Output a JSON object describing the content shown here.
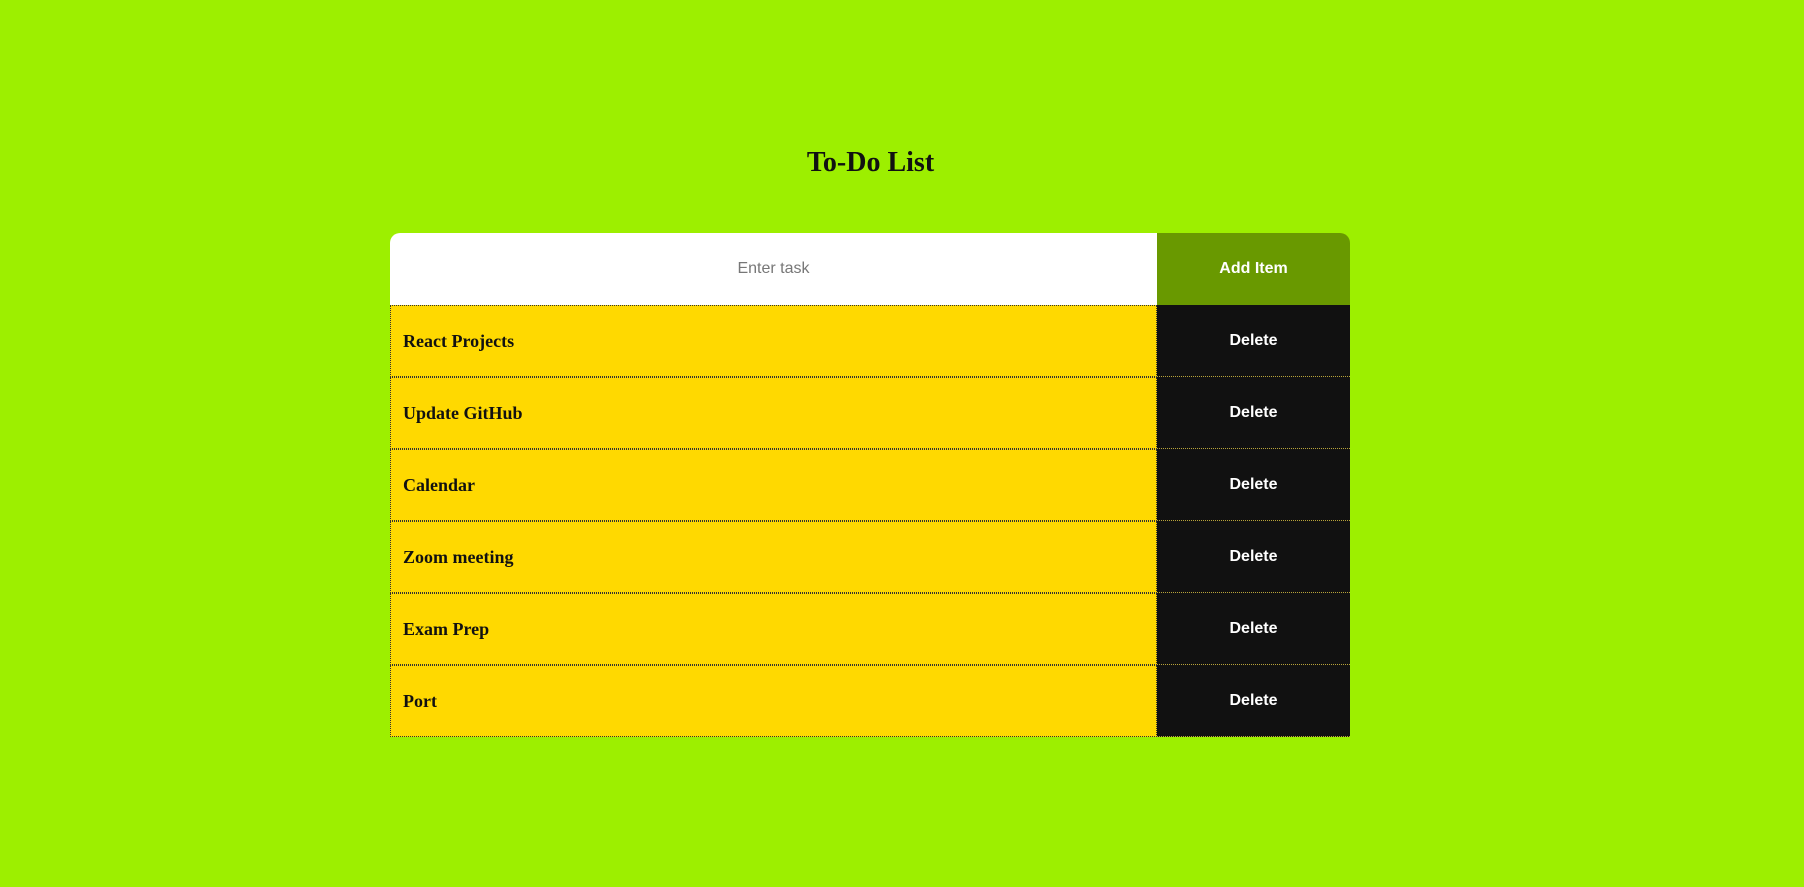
{
  "header": {
    "title": "To-Do List"
  },
  "form": {
    "placeholder": "Enter task",
    "value": "",
    "add_label": "Add Item"
  },
  "tasks": [
    {
      "label": "React Projects",
      "delete_label": "Delete"
    },
    {
      "label": "Update GitHub",
      "delete_label": "Delete"
    },
    {
      "label": "Calendar",
      "delete_label": "Delete"
    },
    {
      "label": "Zoom meeting",
      "delete_label": "Delete"
    },
    {
      "label": "Exam Prep",
      "delete_label": "Delete"
    },
    {
      "label": "Port",
      "delete_label": "Delete"
    }
  ],
  "colors": {
    "background": "#9def00",
    "add_button": "#699900",
    "task_background": "#ffd900",
    "delete_button": "#111111",
    "input_background": "#ffffff"
  }
}
